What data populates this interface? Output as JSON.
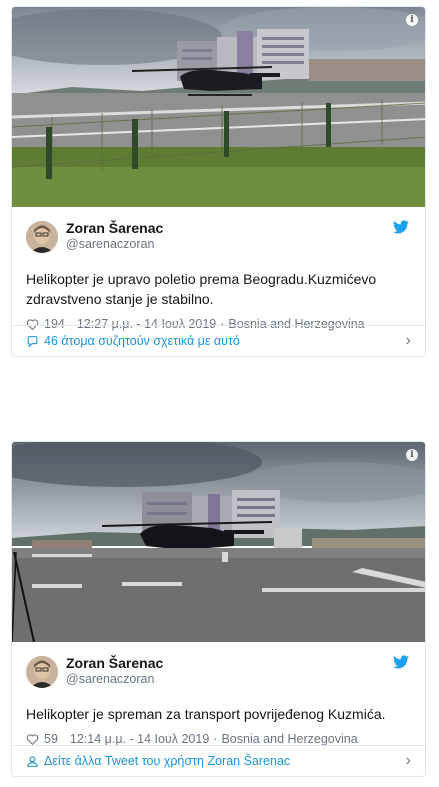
{
  "tweets": [
    {
      "author_name": "Zoran Šarenac",
      "author_handle": "@sarenaczoran",
      "text": "Helikopter je upravo poletio prema Beogradu.Kuzmićevo zdravstveno stanje je stabilno.",
      "likes": "194",
      "timestamp": "12:27 μ.μ. - 14 Ιουλ 2019",
      "location": "Bosnia and Herzegovina",
      "footer_text": "46 άτομα συζητούν σχετικά με αυτό",
      "footer_icon": "comment-bubble-icon",
      "media_icon": "info-icon"
    },
    {
      "author_name": "Zoran Šarenac",
      "author_handle": "@sarenaczoran",
      "text": "Helikopter je spreman za transport povrijeđenog Kuzmića.",
      "likes": "59",
      "timestamp": "12:14 μ.μ. - 14 Ιουλ 2019",
      "location": "Bosnia and Herzegovina",
      "footer_text": "Δείτε άλλα Tweet του χρήστη Zoran Šarenac",
      "footer_icon": "person-icon",
      "media_icon": "info-icon"
    }
  ],
  "colors": {
    "link": "#1b95e0",
    "muted": "#657786",
    "border": "#e1e8ed",
    "twitter_blue": "#1da1f2"
  }
}
